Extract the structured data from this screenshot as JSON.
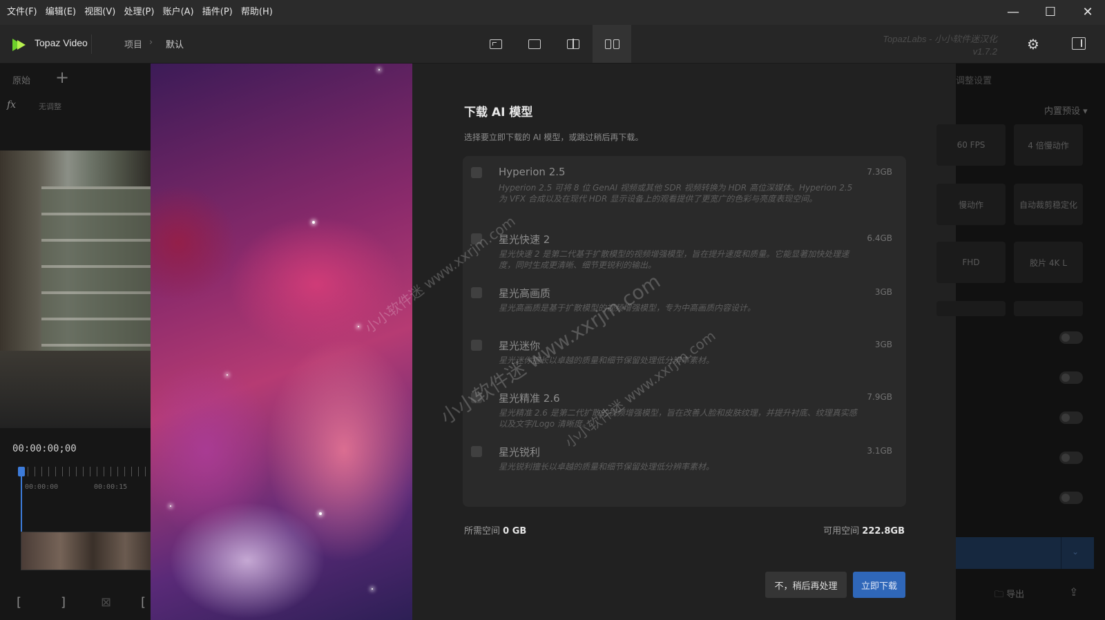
{
  "menu": [
    "文件(F)",
    "编辑(E)",
    "视图(V)",
    "处理(P)",
    "账户(A)",
    "插件(P)",
    "帮助(H)"
  ],
  "window_controls": {
    "minimize": "—",
    "maximize": "☐",
    "close": "✕"
  },
  "app": {
    "name": "Topaz Video",
    "breadcrumb": [
      "项目",
      "默认"
    ],
    "brand": "TopazLabs - 小小软件迷汉化",
    "version": "v1.7.2"
  },
  "left_panel": {
    "tab": "原始",
    "fx_label": "无调整",
    "timecode": "00:00:00;00",
    "ticks": [
      "00:00:00",
      "00:00:15"
    ]
  },
  "dialog": {
    "title": "下载 AI 模型",
    "description": "选择要立即下载的 AI 模型，或跳过稍后再下载。",
    "models": [
      {
        "name": "Hyperion 2.5",
        "size": "7.3GB",
        "desc": "Hyperion 2.5 可将 8 位 GenAI 视频或其他 SDR 视频转换为 HDR 高位深媒体。Hyperion 2.5 为 VFX 合成以及在现代 HDR 显示设备上的观看提供了更宽广的色彩与亮度表现空间。"
      },
      {
        "name": "星光快速 2",
        "size": "6.4GB",
        "desc": "星光快速 2 是第二代基于扩散模型的视频增强模型，旨在提升速度和质量。它能显著加快处理速度，同时生成更清晰、细节更锐利的输出。"
      },
      {
        "name": "星光高画质",
        "size": "3GB",
        "desc": "星光高画质是基于扩散模型的视频增强模型，专为中高画质内容设计。"
      },
      {
        "name": "星光迷你",
        "size": "3GB",
        "desc": "星光迷你擅长以卓越的质量和细节保留处理低分辨率素材。"
      },
      {
        "name": "星光精准 2.6",
        "size": "7.9GB",
        "desc": "星光精准 2.6 是第二代扩散的视频增强模型，旨在改善人脸和皮肤纹理，并提升衬底、纹理真实感以及文字/Logo 清晰度。"
      },
      {
        "name": "星光锐利",
        "size": "3.1GB",
        "desc": "星光锐利擅长以卓越的质量和细节保留处理低分辨率素材。"
      }
    ],
    "required_label": "所需空间",
    "required_value": "0 GB",
    "available_label": "可用空间",
    "available_value": "222.8GB",
    "later_button": "不，稍后再处理",
    "download_button": "立即下载"
  },
  "right_panel": {
    "title": "调整设置",
    "preset": "内置预设",
    "presets": [
      "60 FPS",
      "4 倍慢动作",
      "慢动作",
      "自动裁剪稳定化",
      "FHD",
      "胶片 4K L"
    ],
    "export": "导出"
  },
  "watermark": [
    "小小软件迷 www.xxrjm.com",
    "小小软件迷 www.xxrjm.com",
    "小小软件迷 www.xxrjm.com"
  ]
}
